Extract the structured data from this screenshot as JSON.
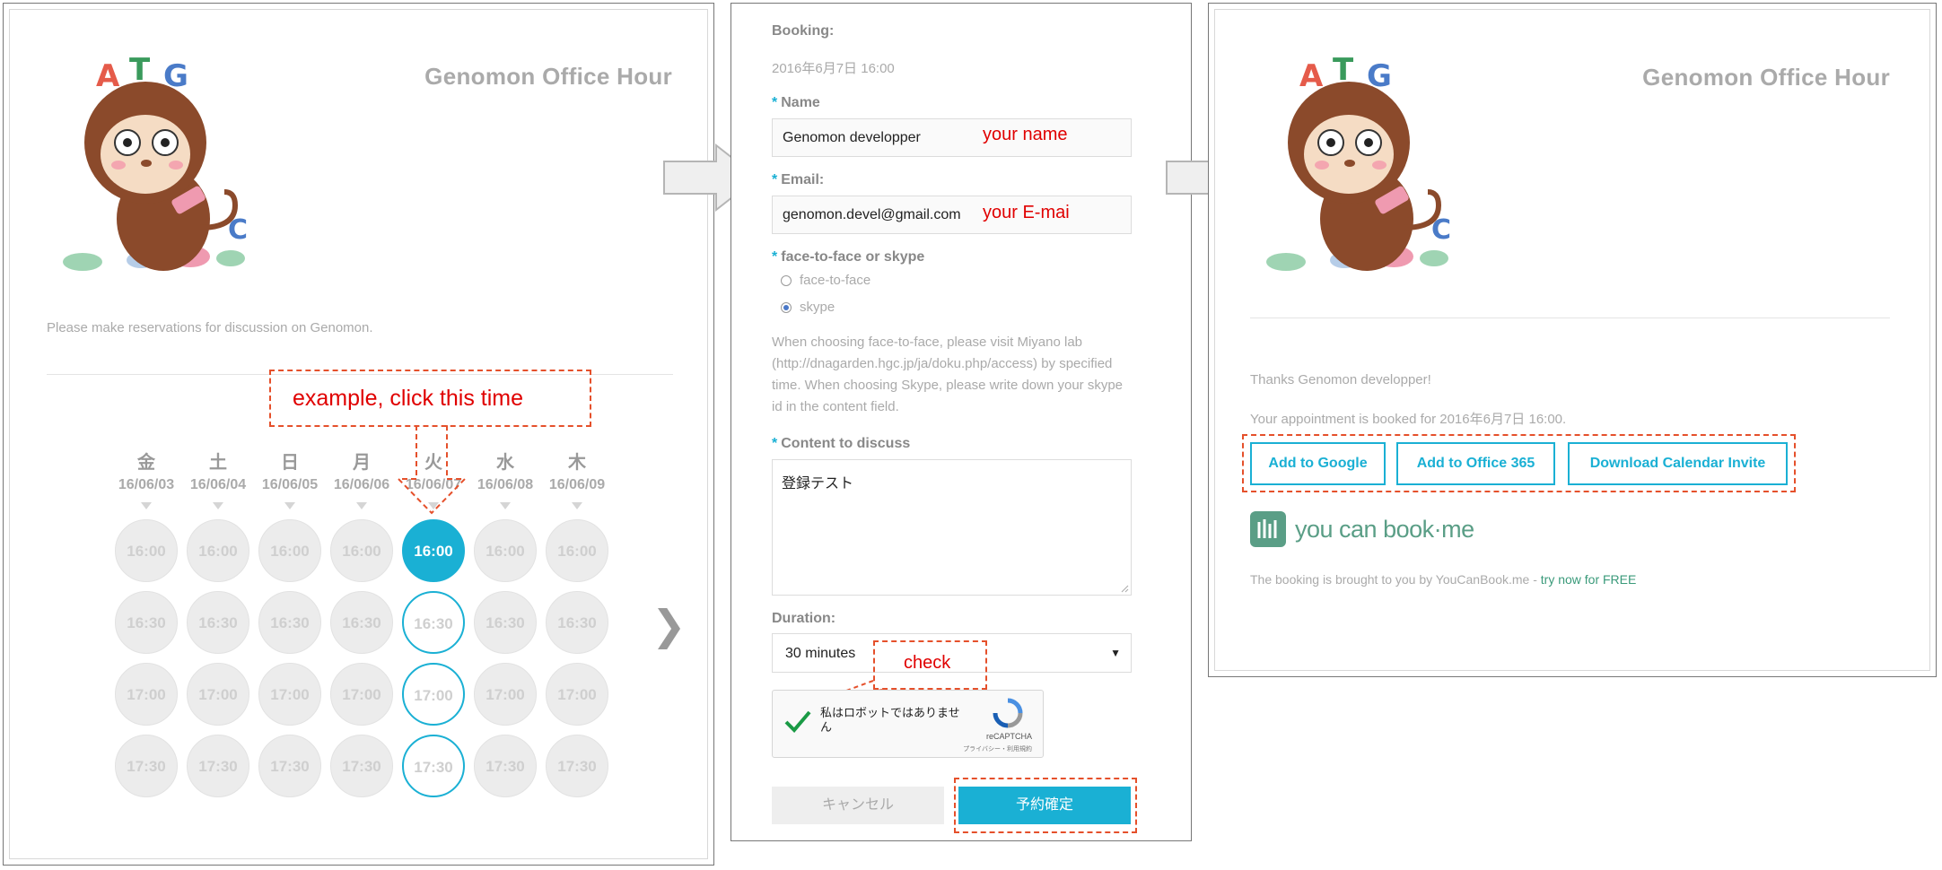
{
  "colors": {
    "accent": "#1ab0d4",
    "annotation": "#e5502b",
    "annotation_text": "#e00000",
    "logo_green": "#5a9e86"
  },
  "step1": {
    "title": "Genomon Office Hour",
    "intro": "Please make reservations for discussion on Genomon.",
    "annotation": "example, click this time",
    "days": [
      {
        "name": "金",
        "date": "16/06/03"
      },
      {
        "name": "土",
        "date": "16/06/04"
      },
      {
        "name": "日",
        "date": "16/06/05"
      },
      {
        "name": "月",
        "date": "16/06/06"
      },
      {
        "name": "火",
        "date": "16/06/07"
      },
      {
        "name": "水",
        "date": "16/06/08"
      },
      {
        "name": "木",
        "date": "16/06/09"
      }
    ],
    "times": [
      "16:00",
      "16:30",
      "17:00",
      "17:30"
    ],
    "selected_time": "16:00",
    "next_icon": "chevron-right-icon"
  },
  "step2": {
    "booking_label": "Booking:",
    "booking_value": "2016年6月7日 16:00",
    "required_mark": "*",
    "name_label": "Name",
    "name_value": "Genomon developper",
    "name_annotation": "your name",
    "email_label": "Email:",
    "email_value": "genomon.devel@gmail.com",
    "email_annotation": "your E-mai",
    "meeting_label": "face-to-face or skype",
    "meeting_options": [
      "face-to-face",
      "skype"
    ],
    "meeting_selected": "skype",
    "meeting_note": "When choosing face-to-face, please visit Miyano lab (http://dnagarden.hgc.jp/ja/doku.php/access) by specified time. When choosing Skype, please write down your skype id in the content field.",
    "content_label": "Content to discuss",
    "content_value": "登録テスト",
    "duration_label": "Duration:",
    "duration_value": "30 minutes",
    "check_annotation": "check",
    "recaptcha_text": "私はロボットではありません",
    "recaptcha_brand": "reCAPTCHA",
    "recaptcha_links": "プライバシー・利用規約",
    "cancel_label": "キャンセル",
    "confirm_label": "予約確定"
  },
  "step3": {
    "title": "Genomon Office Hour",
    "thanks": "Thanks Genomon developper!",
    "booked": "Your appointment is booked for 2016年6月7日 16:00.",
    "buttons": [
      "Add to Google",
      "Add to Office 365",
      "Download Calendar Invite"
    ],
    "logo_text": "you can book·me",
    "footer": "The booking is brought to you by YouCanBook.me - ",
    "footer_link": "try now for FREE"
  }
}
